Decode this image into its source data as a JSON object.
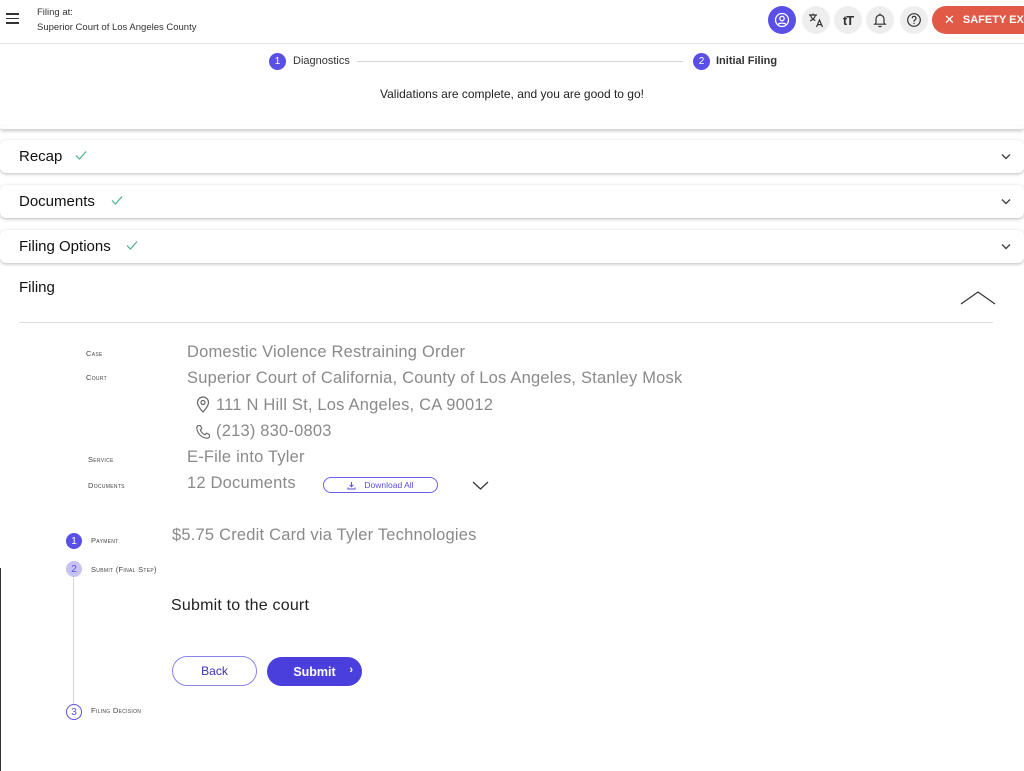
{
  "header": {
    "filing_at_label": "Filing at:",
    "court_name": "Superior Court of Los Angeles County",
    "safety_exit_label": "SAFETY EXIT",
    "font_size_glyph": "tT",
    "icons": [
      "menu-icon",
      "user-icon",
      "translate-icon",
      "font-size-icon",
      "bell-icon",
      "help-icon",
      "close-icon"
    ]
  },
  "stepper": {
    "steps": [
      {
        "number": "1",
        "label": "Diagnostics"
      },
      {
        "number": "2",
        "label": "Initial Filing"
      }
    ]
  },
  "validation_message": "Validations are complete, and you are good to go!",
  "sections": {
    "recap": "Recap",
    "documents": "Documents",
    "filing_options": "Filing Options",
    "filing": "Filing"
  },
  "filing": {
    "case_label": "Case",
    "case_value": "Domestic Violence Restraining Order",
    "court_label": "Court",
    "court_value": "Superior Court of California, County of Los Angeles, Stanley Mosk",
    "address": "111 N Hill St, Los Angeles, CA 90012",
    "phone": "(213) 830-0803",
    "service_label": "Service",
    "service_value": "E-File into Tyler",
    "documents_label": "Documents",
    "documents_value": "12 Documents",
    "download_all_label": "Download All"
  },
  "timeline": {
    "steps": [
      {
        "number": "1",
        "label": "Payment",
        "value": "$5.75 Credit Card via Tyler Technologies"
      },
      {
        "number": "2",
        "label": "Submit (Final Step)"
      },
      {
        "number": "3",
        "label": "Filing Decision"
      }
    ],
    "submit_heading": "Submit to the court",
    "back_label": "Back",
    "submit_label": "Submit"
  },
  "colors": {
    "accent": "#5a4fe6",
    "safety_exit": "#e05a47",
    "check": "#4caf92"
  }
}
